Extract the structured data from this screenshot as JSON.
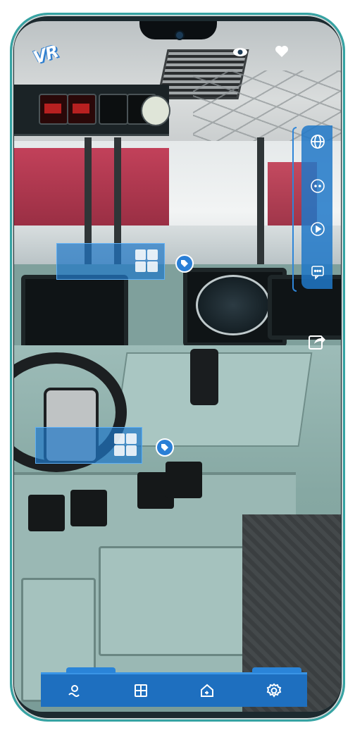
{
  "app": {
    "logo_text": "VR"
  },
  "top_bar": {
    "icons": [
      "eye-icon",
      "heart-icon"
    ]
  },
  "side_menu": {
    "items": [
      {
        "icon": "globe-icon"
      },
      {
        "icon": "more-dots-icon"
      },
      {
        "icon": "play-icon"
      },
      {
        "icon": "chat-icon"
      }
    ],
    "share_icon": "share-icon"
  },
  "hotspots": [
    {
      "icon": "tag-icon"
    },
    {
      "icon": "tag-icon"
    }
  ],
  "bottom_nav": {
    "items": [
      {
        "icon": "location-icon"
      },
      {
        "icon": "catalog-icon"
      },
      {
        "icon": "home-icon"
      },
      {
        "icon": "settings-icon"
      }
    ]
  },
  "colors": {
    "accent": "#1e6fbf",
    "panel": "#2078c8",
    "frame": "#36a3a3"
  }
}
